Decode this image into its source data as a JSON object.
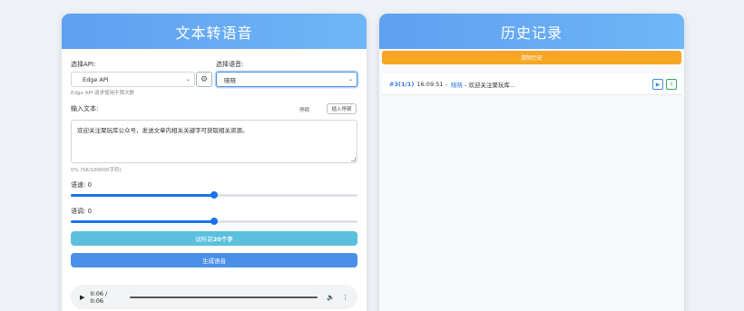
{
  "left_panel": {
    "title": "文本转语音",
    "api_label": "选择API:",
    "api_value": "Edge API",
    "api_hint": "Edge API 请求使用不限次数",
    "voice_label": "选择语音:",
    "voice_value": "晓晓",
    "text_label": "输入文本:",
    "pause_label": "停顿",
    "insert_pause_button": "插入停顿",
    "text_value": "欢迎关注聚玩库公众号，发送文章内相关关键字可获取相关资源。",
    "char_count": "0% (56/100000字符)",
    "speed_label": "语速: 0",
    "speed_level": 0.5,
    "pitch_label": "语调: 0",
    "pitch_level": 0.5,
    "preview_button_prefix": "试听前",
    "preview_button_bold": "20个字",
    "generate_button": "生成语音",
    "audio": {
      "time": "0:06 / 0:06",
      "progress": 1.0
    },
    "colors": {
      "preview": "#5bc0de",
      "generate": "#4a8fe8"
    }
  },
  "right_panel": {
    "title": "历史记录",
    "clear_button": "清除历史",
    "items": [
      {
        "index": "#3(1/1)",
        "time": "16:09:51",
        "sep": "-",
        "voice": "晓晓",
        "text": "- 欢迎关注聚玩库..."
      }
    ]
  },
  "icons": {
    "settings": "gear-icon",
    "play": "play-icon",
    "download": "download-icon",
    "volume": "volume-icon",
    "more": "more-vertical-icon"
  }
}
